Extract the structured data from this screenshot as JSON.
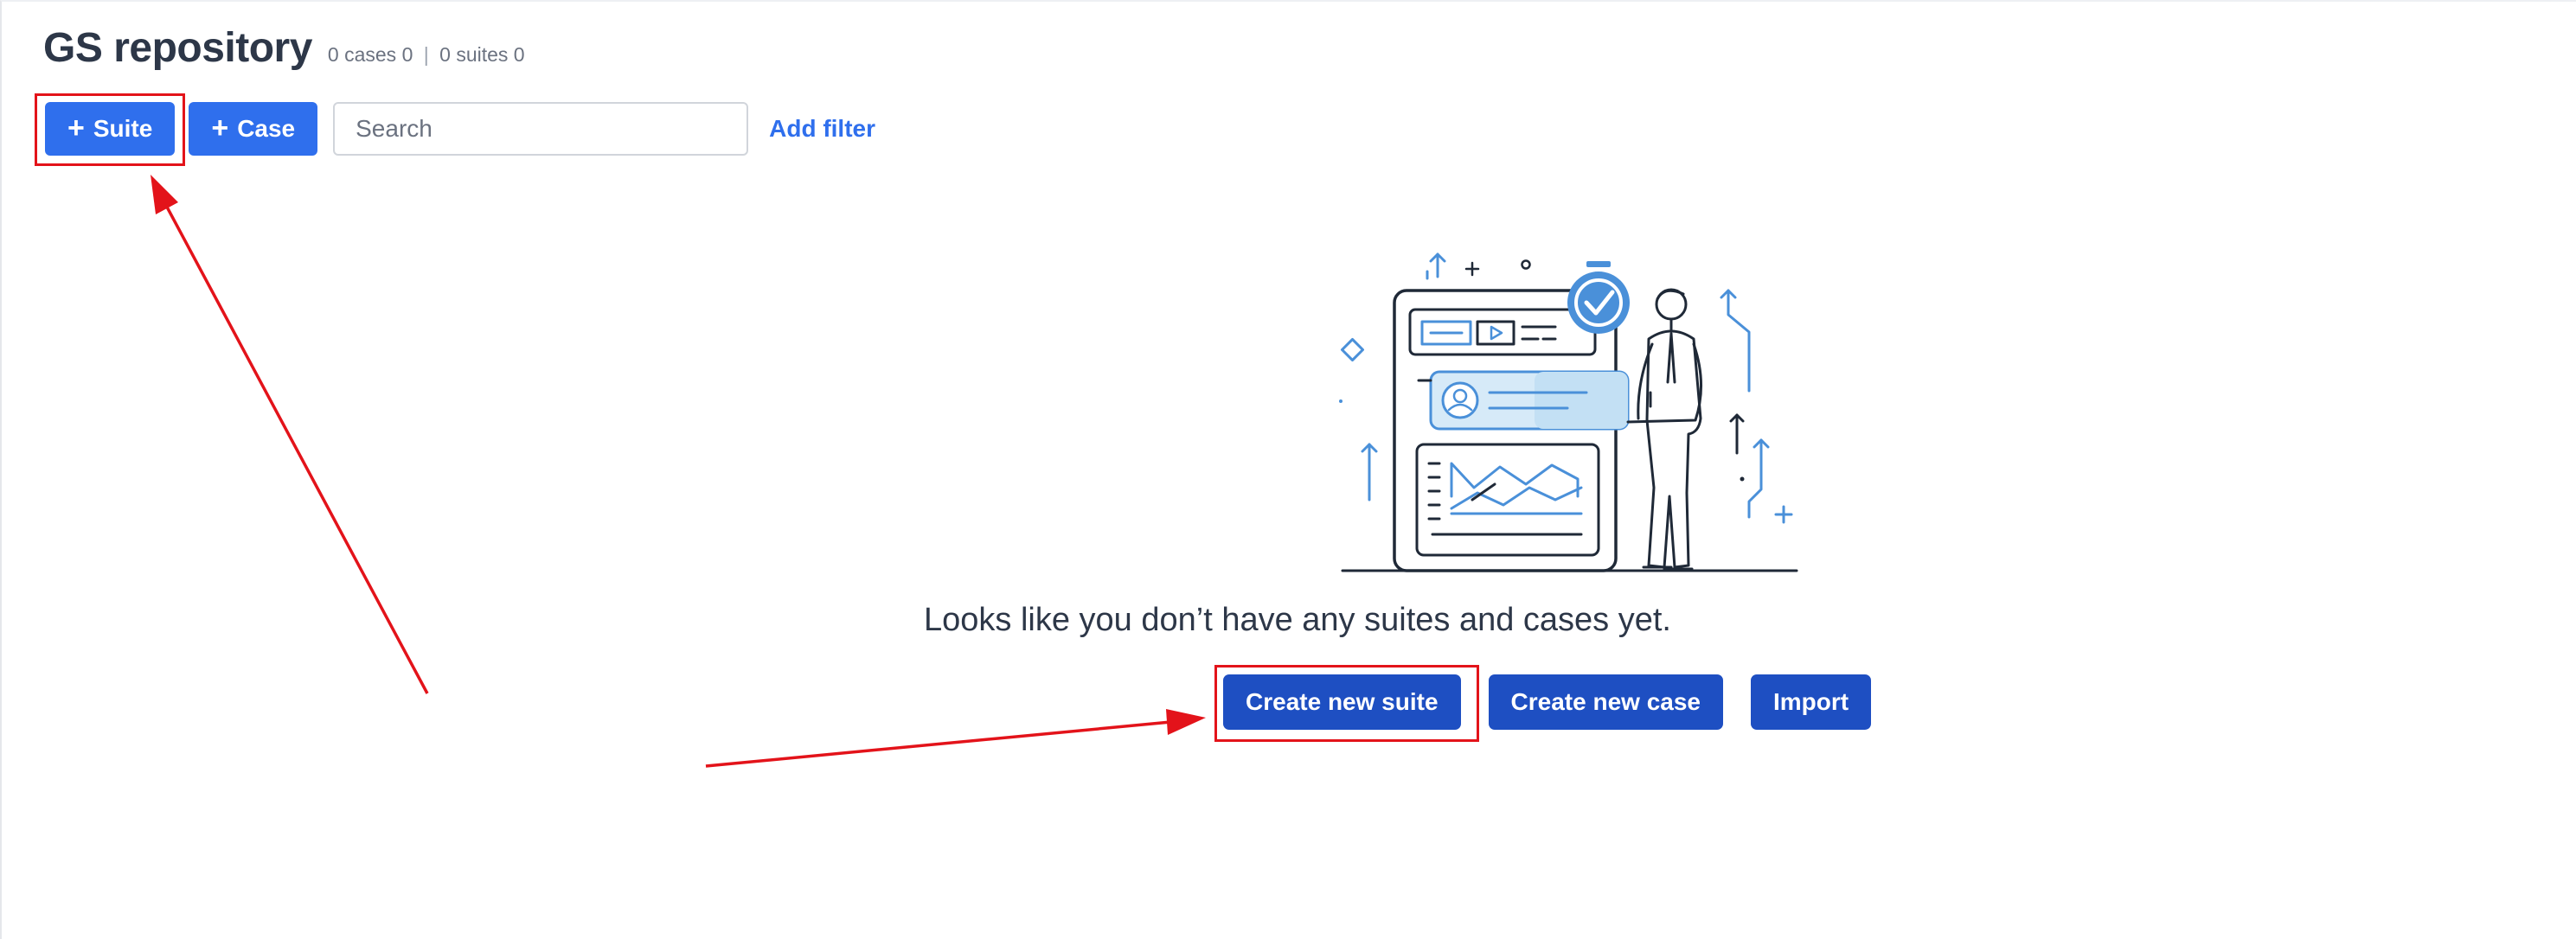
{
  "header": {
    "title": "GS repository",
    "cases_text": "0 cases 0",
    "separator": "|",
    "suites_text": "0 suites 0"
  },
  "toolbar": {
    "suite_button": {
      "icon": "plus-icon",
      "plus": "+",
      "label": "Suite"
    },
    "case_button": {
      "icon": "plus-icon",
      "plus": "+",
      "label": "Case"
    },
    "search": {
      "placeholder": "Search",
      "value": ""
    },
    "add_filter_label": "Add filter"
  },
  "empty_state": {
    "illustration": "person-with-dashboard-illustration",
    "message": "Looks like you don’t have any suites and cases yet.",
    "buttons": {
      "create_suite": "Create new suite",
      "create_case": "Create new case",
      "import": "Import"
    }
  },
  "annotations": {
    "highlight_color": "#e3131a",
    "items": [
      "highlight-box-suite-button",
      "highlight-box-create-suite",
      "arrow-to-suite-button",
      "arrow-to-create-suite"
    ]
  },
  "colors": {
    "primary": "#2f6fed",
    "primary_dark": "#1e4fc2",
    "title": "#2d3748",
    "illustration_blue": "#4a90d9",
    "illustration_line": "#1f2937"
  }
}
